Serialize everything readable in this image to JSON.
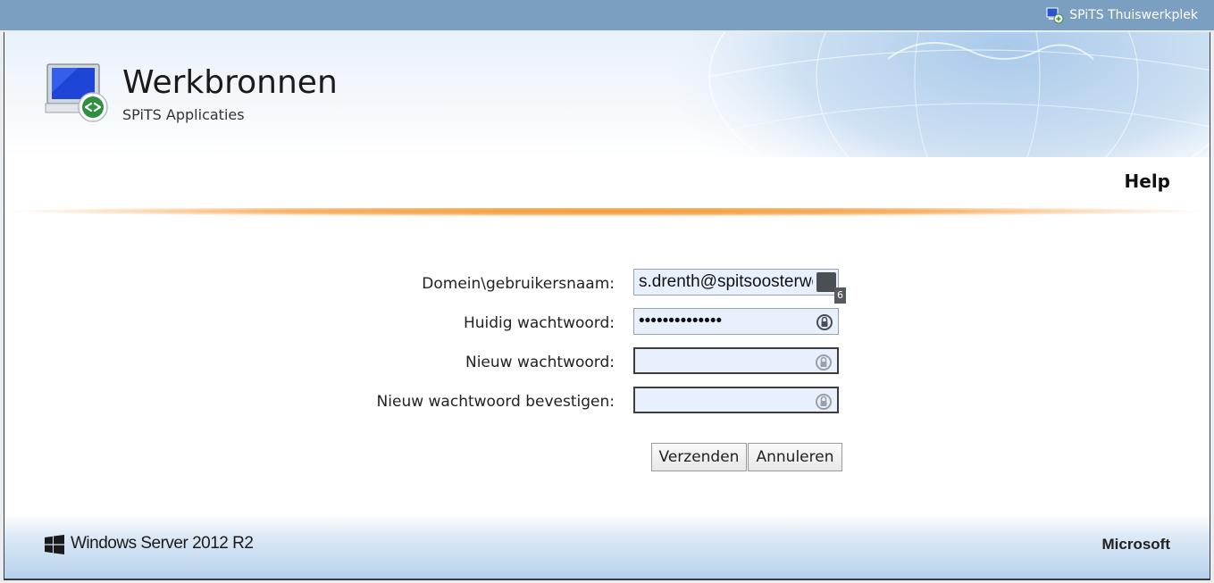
{
  "topbar": {
    "product_name": "SPiTS Thuiswerkplek",
    "product_icon": "remote-app-icon"
  },
  "header": {
    "title": "Werkbronnen",
    "subtitle": "SPiTS Applicaties",
    "help_label": "Help",
    "icon": "remote-desktop-monitor-icon"
  },
  "form": {
    "username": {
      "label": "Domein\\gebruikersnaam:",
      "value": "s.drenth@spitsoosterwolde.nl",
      "manager_badge": "6"
    },
    "current_password": {
      "label": "Huidig wachtwoord:",
      "value": "••••••••••••••"
    },
    "new_password": {
      "label": "Nieuw wachtwoord:",
      "value": ""
    },
    "confirm_password": {
      "label": "Nieuw wachtwoord bevestigen:",
      "value": ""
    },
    "submit_label": "Verzenden",
    "cancel_label": "Annuleren"
  },
  "footer": {
    "os_label": "Windows Server 2012 R2",
    "vendor_label": "Microsoft"
  },
  "colors": {
    "topbar": "#7b9fc0",
    "accent_orange": "#f39a35",
    "field_bg": "#e8f0fe"
  }
}
